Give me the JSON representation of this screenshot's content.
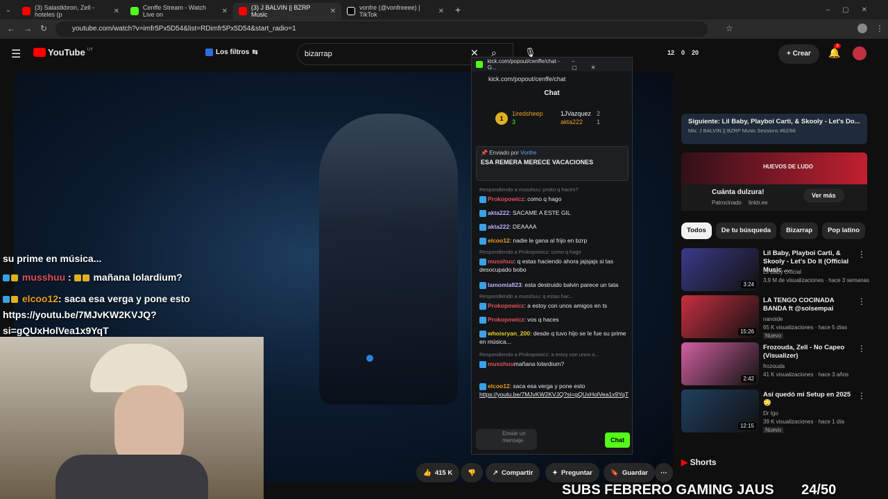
{
  "browser": {
    "tabs": [
      {
        "label": "(3) Salastkbron, Zell - hoteles (p",
        "color": "#ff0000"
      },
      {
        "label": "Cenffe Stream - Watch Live on",
        "color": "#53fc18"
      },
      {
        "label": "(3) J BALVIN || BZRP Music",
        "color": "#ff0000"
      },
      {
        "label": "vonfre (@vonfreeee) | TikTok",
        "color": "#ffffff"
      }
    ],
    "url": "youtube.com/watch?v=imfr5Px5D54&list=RDimfr5Px5D54&start_radio=1"
  },
  "youtube": {
    "logo": "YouTube",
    "country": "UY",
    "filters_label": "Los filtros",
    "search_value": "bizarrap",
    "stats": {
      "a": "12",
      "b": "0",
      "c": "20"
    },
    "create_label": "Crear",
    "notif_count": "3"
  },
  "video_overlay": {
    "line1": "su prime en música...",
    "user1": "musshuu",
    "msg1": "mañana lolardium?",
    "user2": "elcoo12",
    "msg2": ": saca esa verga y pone esto",
    "link1": "https://youtu.be/7MJvKW2KVJQ?",
    "link2": "si=gQUxHolVea1x9YqT"
  },
  "kick": {
    "window_title": "kick.com/popout/cenffe/chat - G...",
    "url": "kick.com/popout/cenffe/chat",
    "header": "Chat",
    "leaders": [
      {
        "rank": "1",
        "name": "1iredsheep",
        "count": "3"
      },
      {
        "name": "1JVazquez",
        "count": "2"
      },
      {
        "name": "akta222",
        "count": "1"
      }
    ],
    "pinned_by_label": "Enviado por",
    "pinned_user": "Vonfre",
    "pinned_text": "ESA REMERA MERECE VACACIONES",
    "messages": [
      {
        "reply": "Respondiendo a musshuu: proko q hacés?",
        "user": "Prokopowicz",
        "text": ": como q hago",
        "ucolor": "#e0505a"
      },
      {
        "user": "akta222",
        "text": ": SACAME A ESTE GIL",
        "ucolor": "#b8b4ff"
      },
      {
        "user": "akta222",
        "text": ": DEAAAA",
        "ucolor": "#b8b4ff"
      },
      {
        "user": "elcoo12",
        "text": ": nadie le gana al frijo en bzrp",
        "ucolor": "#e8a020"
      },
      {
        "reply": "Respondiendo a Prokopowicz: como q hago",
        "user": "musshuu",
        "text": ": q estas haciendo ahora jajsjajs si tas desocupado bobo",
        "ucolor": "#e0505a"
      },
      {
        "user": "lamomia823",
        "text": ": esta destruido balvin parece un tata",
        "ucolor": "#b8b4ff"
      },
      {
        "reply": "Respondiendo a musshuu: q estas hac...",
        "user": "Prokopowicz",
        "text": ": a estoy con unos amigos en ts",
        "ucolor": "#e0505a"
      },
      {
        "user": "Prokopowicz",
        "text": ": vos q haces",
        "ucolor": "#e0505a"
      },
      {
        "user": "whoisryan_200",
        "text": ": desde q tuvo hijo se le fue su prime en música...",
        "ucolor": "#e8d020"
      },
      {
        "reply": "Respondiendo a Prokopowicz: a estoy con unos a...",
        "user": "musshuu",
        "text": "mañana lolardium?",
        "ucolor": "#e0505a"
      },
      {
        "user": "elcoo12",
        "text": ": saca esa verga y pone esto",
        "ucolor": "#e8a020",
        "link": "https://youtu.be/7MJvKW2KVJQ?si=gQUxHolVea1x9YqT"
      }
    ],
    "input_placeholder": "Enviar un mensaje",
    "send_label": "Chat"
  },
  "sidebar": {
    "next_label": "Siguiente: Lil Baby, Playboi Carti, & Skooly - Let's Do...",
    "mix_label": "Mix: J BALVIN || BZRP Music Sessions #62/66",
    "ad_banner": "HUEVOS DE LUDO",
    "ad_title": "Cuánta dulzura!",
    "ad_sponsored": "Patrocinado",
    "ad_domain": "linktr.ee",
    "ad_button": "Ver más",
    "chips": [
      "Todos",
      "De tu búsqueda",
      "Bizarrap",
      "Pop latino"
    ],
    "recs": [
      {
        "title": "Lil Baby, Playboi Carti, & Skooly - Let's Do It (Official Music ...",
        "channel": "Lil Baby Official",
        "meta": "3,9 M de visualizaciones · hace 3 semanas",
        "duration": "3:24",
        "color": "#3a3a8a"
      },
      {
        "title": "LA TENGO COCINADA BANDA ft @solsempai",
        "channel": "nanoide",
        "meta": "65 K visualizaciones · hace 5 días",
        "badge": "Nuevo",
        "duration": "15:26",
        "color": "#c83040"
      },
      {
        "title": "Frozouda, Zell - No Capeo (Visualizer)",
        "channel": "frozouda",
        "meta": "41 K visualizaciones · hace 3 años",
        "duration": "2:42",
        "color": "#d060a0"
      },
      {
        "title": "Así quedó mi Setup en 2025 😳",
        "channel": "Dr Igo",
        "meta": "39 K visualizaciones · hace 1 día",
        "badge": "Nuevo",
        "duration": "12:15",
        "color": "#204060"
      }
    ],
    "shorts_label": "Shorts"
  },
  "actions": {
    "likes": "415 K",
    "share": "Compartir",
    "ask": "Preguntar",
    "save": "Guardar"
  },
  "stream_banner": "SUBS FEBRERO GAMING JAUS",
  "sub_count": "24/50"
}
